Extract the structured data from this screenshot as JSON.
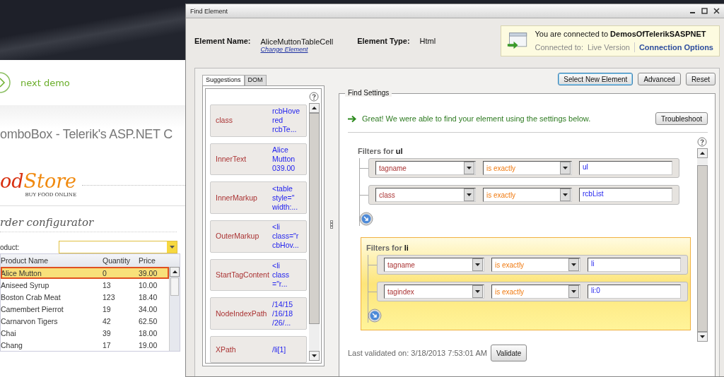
{
  "background_page": {
    "next_demo": "next demo",
    "title": "omboBox - Telerik's ASP.NET C",
    "logo_lead": "od",
    "logo_main": "Store",
    "logo_tagline": "BUY FOOD ONLINE",
    "section_title": "rder configurator",
    "product_label": "oduct:",
    "grid": {
      "columns": [
        "Product Name",
        "Quantity",
        "Price"
      ],
      "rows": [
        {
          "name": "Alice Mutton",
          "quantity": "0",
          "price": "39.00",
          "selected": true
        },
        {
          "name": "Aniseed Syrup",
          "quantity": "13",
          "price": "10.00",
          "selected": false
        },
        {
          "name": "Boston Crab Meat",
          "quantity": "123",
          "price": "18.40",
          "selected": false
        },
        {
          "name": "Camembert Pierrot",
          "quantity": "19",
          "price": "34.00",
          "selected": false
        },
        {
          "name": "Carnarvon Tigers",
          "quantity": "42",
          "price": "62.50",
          "selected": false
        },
        {
          "name": "Chai",
          "quantity": "39",
          "price": "18.00",
          "selected": false
        },
        {
          "name": "Chang",
          "quantity": "17",
          "price": "19.00",
          "selected": false
        }
      ]
    }
  },
  "window": {
    "title": "Find Element"
  },
  "element": {
    "name_label": "Element Name:",
    "name": "AliceMuttonTableCell",
    "change_link": "Change Element",
    "type_label": "Element Type:",
    "type": "Html"
  },
  "connection": {
    "message": "You are connected to",
    "target": "DemosOfTelerikSASPNET",
    "connected_label": "Connected to:",
    "connected_value": "Live Version",
    "options_link": "Connection Options"
  },
  "buttons": [
    {
      "label": "Select New Element",
      "focused": true
    },
    {
      "label": "Advanced",
      "focused": false
    },
    {
      "label": "Reset",
      "focused": false
    }
  ],
  "tabs": [
    {
      "label": "Suggestions",
      "selected": true
    },
    {
      "label": "DOM",
      "selected": false
    }
  ],
  "suggestions": [
    {
      "name": "class",
      "value_lines": [
        "rcbHove",
        "red",
        "rcbTe..."
      ]
    },
    {
      "name": "InnerText",
      "value_lines": [
        "Alice",
        "Mutton",
        "039.00"
      ]
    },
    {
      "name": "InnerMarkup",
      "value_lines": [
        "<table",
        "style=\"",
        "width:..."
      ]
    },
    {
      "name": "OuterMarkup",
      "value_lines": [
        "<li",
        "class=\"r",
        "cbHov..."
      ]
    },
    {
      "name": "StartTagContent",
      "value_lines": [
        "<li",
        "class",
        "=\"r..."
      ]
    },
    {
      "name": "NodeIndexPath",
      "value_lines": [
        "/14/15",
        "/16/18",
        "/26/..."
      ]
    },
    {
      "name": "XPath",
      "value_lines": [
        "/li[1]"
      ]
    }
  ],
  "find_settings": {
    "legend": "Find Settings",
    "message": "Great! We were able to find your element using the settings below.",
    "troubleshoot": "Troubleshoot",
    "groups": [
      {
        "label": "Filters for",
        "target": "ul",
        "highlighted": false,
        "rows": [
          {
            "attribute": "tagname",
            "comparison": "is exactly",
            "value": "ul"
          },
          {
            "attribute": "class",
            "comparison": "is exactly",
            "value": "rcbList"
          }
        ]
      },
      {
        "label": "Filters for",
        "target": "li",
        "highlighted": true,
        "rows": [
          {
            "attribute": "tagname",
            "comparison": "is exactly",
            "value": "li"
          },
          {
            "attribute": "tagindex",
            "comparison": "is exactly",
            "value": "li:0"
          }
        ]
      }
    ],
    "last_validated": "Last validated on: 3/18/2013 7:53:01 AM",
    "validate": "Validate"
  }
}
